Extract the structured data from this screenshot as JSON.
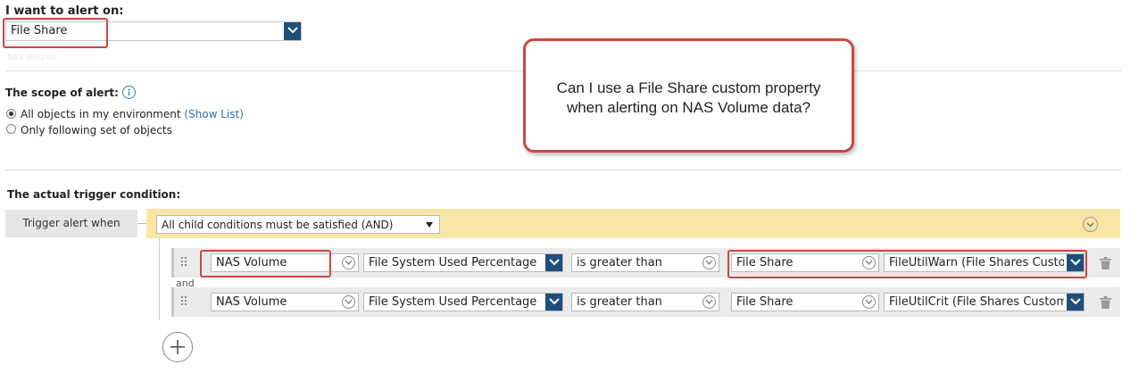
{
  "alert_on": {
    "label": "I want to alert on:",
    "value": "File Share",
    "below_text": "NAS Volume"
  },
  "scope": {
    "label": "The scope of alert:",
    "info_icon": "info-icon",
    "options": [
      {
        "label": "All objects in my environment",
        "link": "(Show List)",
        "selected": true
      },
      {
        "label": "Only following set of objects",
        "selected": false
      }
    ]
  },
  "callout": {
    "line1": "Can I use a File Share custom property",
    "line2": "when alerting on NAS Volume data?"
  },
  "trigger": {
    "title": "The actual trigger condition:",
    "when_label": "Trigger alert when",
    "group_mode": "All child conditions must be satisfied (AND)",
    "and_label": "and",
    "conditions": [
      {
        "object": "NAS Volume",
        "field": "File System Used Percentage",
        "operator": "is greater than",
        "compare_object": "File Share",
        "compare_field": "FileUtilWarn (File Shares Custom"
      },
      {
        "object": "NAS Volume",
        "field": "File System Used Percentage",
        "operator": "is greater than",
        "compare_object": "File Share",
        "compare_field": "FileUtilCrit (File Shares Custom F"
      }
    ]
  },
  "colors": {
    "accent_blue": "#1f4e79",
    "highlight_red": "#c9483f",
    "group_bar": "#f8e6a6",
    "link": "#2f6fae"
  }
}
